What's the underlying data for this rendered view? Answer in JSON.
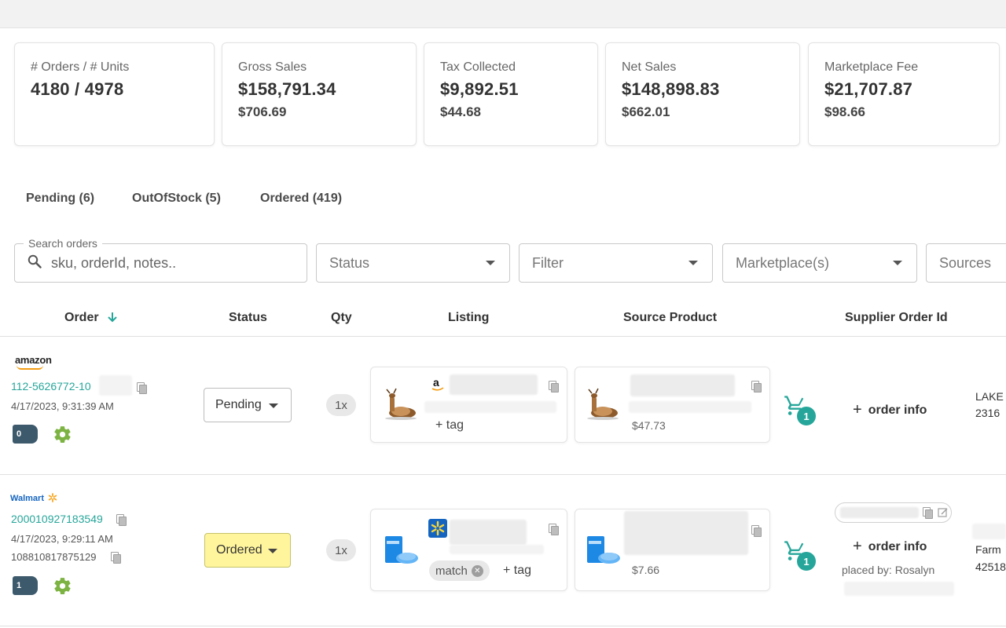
{
  "stats": [
    {
      "label": "# Orders / # Units",
      "value": "4180 / 4978",
      "sub": ""
    },
    {
      "label": "Gross Sales",
      "value": "$158,791.34",
      "sub": "$706.69"
    },
    {
      "label": "Tax Collected",
      "value": "$9,892.51",
      "sub": "$44.68"
    },
    {
      "label": "Net Sales",
      "value": "$148,898.83",
      "sub": "$662.01"
    },
    {
      "label": "Marketplace Fee",
      "value": "$21,707.87",
      "sub": "$98.66"
    }
  ],
  "tabs": [
    "Pending (6)",
    "OutOfStock (5)",
    "Ordered (419)"
  ],
  "filters": {
    "search_legend": "Search orders",
    "search_placeholder": "sku, orderId, notes..",
    "status": "Status",
    "filter": "Filter",
    "marketplaces": "Marketplace(s)",
    "sources": "Sources"
  },
  "columns": [
    "Order",
    "Status",
    "Qty",
    "Listing",
    "Source Product",
    "Supplier Order Id"
  ],
  "orders": [
    {
      "marketplace": "amazon",
      "order_id": "112-5626772-10",
      "date": "4/17/2023, 9:31:39 AM",
      "secondary_id": "",
      "tag_count": "0",
      "status": "Pending",
      "qty": "1x",
      "listing_tag": "+ tag",
      "source_price": "$47.73",
      "cart_count": "1",
      "order_info": "order info",
      "placed_by": "",
      "side_line1": "LAKE",
      "side_line2": "2316"
    },
    {
      "marketplace": "Walmart",
      "order_id": "200010927183549",
      "date": "4/17/2023, 9:29:11 AM",
      "secondary_id": "108810817875129",
      "tag_count": "1",
      "status": "Ordered",
      "qty": "1x",
      "listing_chip": "match",
      "listing_tag": "+ tag",
      "source_price": "$7.66",
      "cart_count": "1",
      "order_info": "order info",
      "placed_by": "placed by: Rosalyn",
      "side_line1": "Farm",
      "side_line2": "42518"
    }
  ],
  "colors": {
    "accent": "#26a69a",
    "ordered_bg": "#fff59d",
    "tag_icon": "#3d5a6c",
    "gear": "#7cb342"
  }
}
